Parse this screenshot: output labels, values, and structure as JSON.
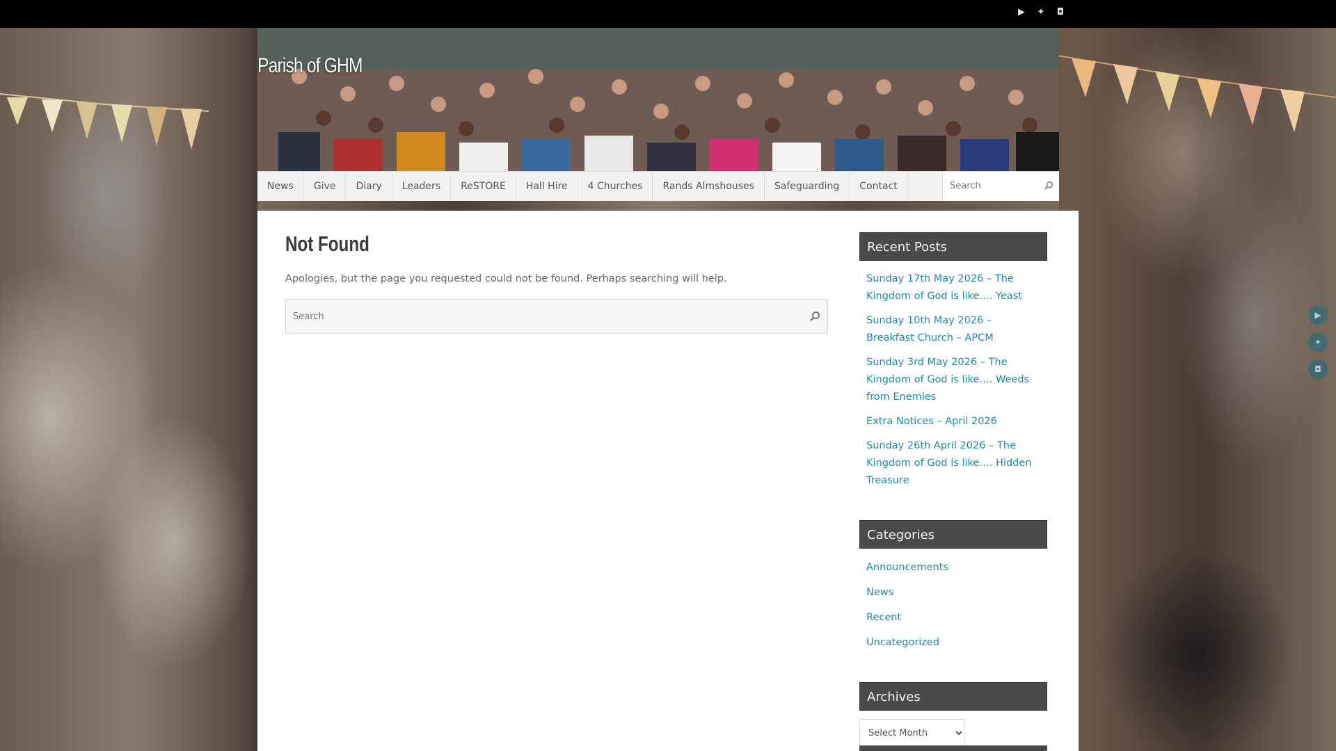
{
  "site": {
    "title": "Parish of GHM"
  },
  "top_social": [
    "youtube-icon",
    "twitter-icon",
    "instagram-icon"
  ],
  "nav": {
    "items": [
      "News",
      "Give",
      "Diary",
      "Leaders",
      "ReSTORE",
      "Hall Hire",
      "4 Churches",
      "Rands Almshouses",
      "Safeguarding",
      "Contact"
    ],
    "search_placeholder": "Search"
  },
  "main": {
    "title": "Not Found",
    "message": "Apologies, but the page you requested could not be found. Perhaps searching will help.",
    "search_placeholder": "Search"
  },
  "sidebar": {
    "recent_posts": {
      "title": "Recent Posts",
      "items": [
        "Sunday 17th May 2026 – The Kingdom of God is like…. Yeast",
        "Sunday 10th May 2026 – Breakfast Church – APCM",
        "Sunday 3rd May 2026 – The Kingdom of God is like…. Weeds from Enemies",
        "Extra Notices – April 2026",
        "Sunday 26th April 2026 – The Kingdom of God is like…. Hidden Treasure"
      ]
    },
    "categories": {
      "title": "Categories",
      "items": [
        "Announcements",
        "News",
        "Recent",
        "Uncategorized"
      ]
    },
    "archives": {
      "title": "Archives",
      "select_value": "Select Month"
    }
  },
  "colors": {
    "link": "#1e8aa8",
    "widget_title_bg": "#4a4a4a",
    "topbar": "#000000"
  }
}
